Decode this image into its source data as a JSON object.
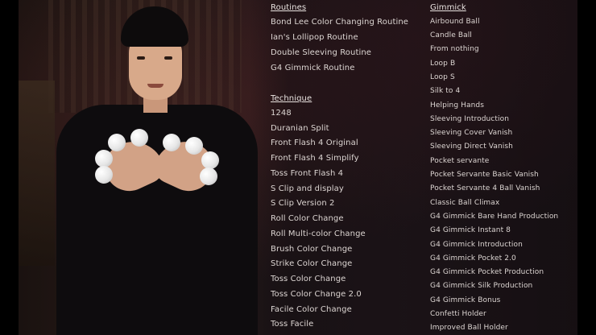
{
  "routines": {
    "heading": "Routines",
    "items": [
      "Bond Lee Color Changing Routine",
      "Ian's Lollipop Routine",
      "Double Sleeving Routine",
      "G4 Gimmick Routine"
    ]
  },
  "technique": {
    "heading": "Technique",
    "items": [
      "1248",
      "Duranian Split",
      "Front Flash 4 Original",
      "Front Flash 4 Simplify",
      "Toss Front Flash 4",
      "S Clip and display",
      "S Clip Version 2",
      "Roll Color Change",
      "Roll Multi-color Change",
      "Brush Color Change",
      "Strike Color Change",
      "Toss Color Change",
      "Toss Color Change 2.0",
      "Facile Color Change",
      "Toss Facile"
    ]
  },
  "gimmick": {
    "heading": "Gimmick",
    "items": [
      "Airbound Ball",
      "Candle Ball",
      "From nothing",
      "Loop B",
      "Loop S",
      "Silk to 4",
      "Helping Hands",
      "Sleeving Introduction",
      "Sleeving Cover Vanish",
      "Sleeving Direct Vanish",
      "Pocket servante",
      "Pocket Servante Basic Vanish",
      "Pocket Servante 4 Ball Vanish",
      "Classic Ball Climax",
      "G4 Gimmick Bare Hand Production",
      "G4 Gimmick Instant 8",
      "G4 Gimmick Introduction",
      "G4 Gimmick Pocket 2.0",
      "G4 Gimmick Pocket Production",
      "G4 Gimmick Silk Production",
      "G4 Gimmick Bonus",
      "Confetti Holder",
      "Improved Ball Holder"
    ]
  }
}
